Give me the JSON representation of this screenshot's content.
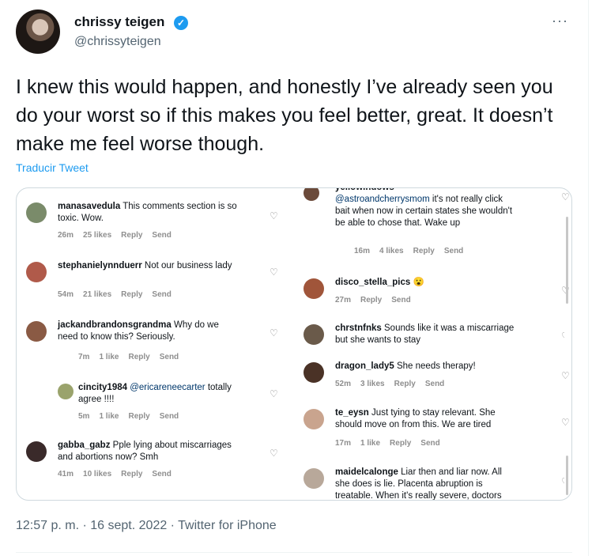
{
  "author": {
    "name": "chrissy teigen",
    "handle": "@chrissyteigen"
  },
  "tweet": {
    "text": "I knew this would happen, and honestly I’ve already seen you do your worst so if this makes you feel better, great. It doesn’t make me feel worse though.",
    "translate_label": "Traducir Tweet",
    "more_label": "···",
    "footer": "12:57 p. m. · 16 sept. 2022 · Twitter for iPhone"
  },
  "comments_left": [
    {
      "user": "manasavedula",
      "text": "This comments section is so toxic. Wow.",
      "time": "26m",
      "likes": "25 likes",
      "reply": "Reply",
      "send": "Send"
    },
    {
      "user": "stephanielynnduerr",
      "text": "Not our business lady",
      "time": "54m",
      "likes": "21 likes",
      "reply": "Reply",
      "send": "Send"
    },
    {
      "user": "jackandbrandonsgrandma",
      "text": "Why do we need to know this? Seriously.",
      "time": "7m",
      "likes": "1 like",
      "reply": "Reply",
      "send": "Send"
    },
    {
      "user": "cincity1984",
      "mention": "@ericareneecarter",
      "text": "totally agree !!!!",
      "time": "5m",
      "likes": "1 like",
      "reply": "Reply",
      "send": "Send"
    },
    {
      "user": "gabba_gabz",
      "text": "Pple lying about miscarriages and abortions now? Smh",
      "time": "41m",
      "likes": "10 likes",
      "reply": "Reply",
      "send": "Send"
    }
  ],
  "comments_right": [
    {
      "user": "yellowindows",
      "mention": "@astroandcherrysmom",
      "text": "it's not really click bait when now in certain states she wouldn't be able to chose that. Wake up",
      "time": "16m",
      "likes": "4 likes",
      "reply": "Reply",
      "send": "Send"
    },
    {
      "user": "disco_stella_pics",
      "text": "😮",
      "time": "27m",
      "reply": "Reply",
      "send": "Send"
    },
    {
      "user": "chrstnfnks",
      "text": "Sounds like it was a miscarriage but she wants to stay"
    },
    {
      "user": "dragon_lady5",
      "text": "She needs therapy!",
      "time": "52m",
      "likes": "3 likes",
      "reply": "Reply",
      "send": "Send"
    },
    {
      "user": "te_eysn",
      "text": "Just tying to stay relevant. She should move on from this. We are tired",
      "time": "17m",
      "likes": "1 like",
      "reply": "Reply",
      "send": "Send"
    },
    {
      "user": "maidelcalonge",
      "text": "Liar then and liar now. All she does is lie. Placenta abruption is treatable. When it's really severe, doctors"
    }
  ],
  "icons": {
    "verified": "verified-badge-icon",
    "heart": "heart-outline-icon",
    "more": "more-dots-icon"
  },
  "colors": {
    "link": "#1d9bf0",
    "verified": "#1d9bf0",
    "mention": "#00376b"
  }
}
